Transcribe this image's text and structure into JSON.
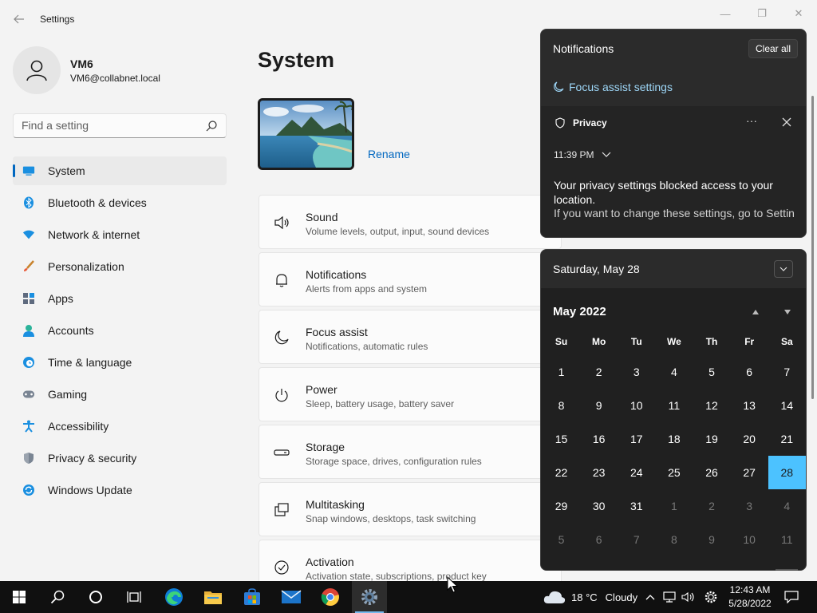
{
  "window": {
    "title": "Settings",
    "back_icon": "back-arrow-icon",
    "minimize_glyph": "—",
    "maximize_glyph": "❐",
    "close_glyph": "✕"
  },
  "profile": {
    "name": "VM6",
    "email": "VM6@collabnet.local"
  },
  "search": {
    "placeholder": "Find a setting"
  },
  "sidebar": {
    "items": [
      {
        "label": "System",
        "icon": "system-display-icon",
        "active": true
      },
      {
        "label": "Bluetooth & devices",
        "icon": "bluetooth-icon"
      },
      {
        "label": "Network & internet",
        "icon": "wifi-icon"
      },
      {
        "label": "Personalization",
        "icon": "brush-icon"
      },
      {
        "label": "Apps",
        "icon": "apps-icon"
      },
      {
        "label": "Accounts",
        "icon": "accounts-icon"
      },
      {
        "label": "Time & language",
        "icon": "globe-clock-icon"
      },
      {
        "label": "Gaming",
        "icon": "gamepad-icon"
      },
      {
        "label": "Accessibility",
        "icon": "accessibility-icon"
      },
      {
        "label": "Privacy & security",
        "icon": "shield-icon"
      },
      {
        "label": "Windows Update",
        "icon": "update-icon"
      }
    ]
  },
  "main": {
    "title": "System",
    "rename_label": "Rename",
    "cards": [
      {
        "title": "Sound",
        "subtitle": "Volume levels, output, input, sound devices",
        "icon": "speaker-icon"
      },
      {
        "title": "Notifications",
        "subtitle": "Alerts from apps and system",
        "icon": "bell-icon"
      },
      {
        "title": "Focus assist",
        "subtitle": "Notifications, automatic rules",
        "icon": "moon-icon"
      },
      {
        "title": "Power",
        "subtitle": "Sleep, battery usage, battery saver",
        "icon": "power-icon"
      },
      {
        "title": "Storage",
        "subtitle": "Storage space, drives, configuration rules",
        "icon": "drive-icon"
      },
      {
        "title": "Multitasking",
        "subtitle": "Snap windows, desktops, task switching",
        "icon": "multitask-icon"
      },
      {
        "title": "Activation",
        "subtitle": "Activation state, subscriptions, product key",
        "icon": "check-circle-icon"
      }
    ]
  },
  "notifications": {
    "header": "Notifications",
    "clear_all": "Clear all",
    "focus_assist_link": "Focus assist settings",
    "card": {
      "app": "Privacy",
      "more": "···",
      "time": "11:39 PM",
      "body": "Your privacy settings blocked access to your location.",
      "detail": "If you want to change these settings, go to Settin"
    }
  },
  "calendar": {
    "date_header": "Saturday, May 28",
    "month_label": "May 2022",
    "weekdays": [
      "Su",
      "Mo",
      "Tu",
      "We",
      "Th",
      "Fr",
      "Sa"
    ],
    "weeks": [
      [
        {
          "d": "1"
        },
        {
          "d": "2"
        },
        {
          "d": "3"
        },
        {
          "d": "4"
        },
        {
          "d": "5"
        },
        {
          "d": "6"
        },
        {
          "d": "7"
        }
      ],
      [
        {
          "d": "8"
        },
        {
          "d": "9"
        },
        {
          "d": "10"
        },
        {
          "d": "11"
        },
        {
          "d": "12"
        },
        {
          "d": "13"
        },
        {
          "d": "14"
        }
      ],
      [
        {
          "d": "15"
        },
        {
          "d": "16"
        },
        {
          "d": "17"
        },
        {
          "d": "18"
        },
        {
          "d": "19"
        },
        {
          "d": "20"
        },
        {
          "d": "21"
        }
      ],
      [
        {
          "d": "22"
        },
        {
          "d": "23"
        },
        {
          "d": "24"
        },
        {
          "d": "25"
        },
        {
          "d": "26"
        },
        {
          "d": "27"
        },
        {
          "d": "28",
          "today": true
        }
      ],
      [
        {
          "d": "29"
        },
        {
          "d": "30"
        },
        {
          "d": "31"
        },
        {
          "d": "1",
          "other": true
        },
        {
          "d": "2",
          "other": true
        },
        {
          "d": "3",
          "other": true
        },
        {
          "d": "4",
          "other": true
        }
      ],
      [
        {
          "d": "5",
          "other": true
        },
        {
          "d": "6",
          "other": true
        },
        {
          "d": "7",
          "other": true
        },
        {
          "d": "8",
          "other": true
        },
        {
          "d": "9",
          "other": true
        },
        {
          "d": "10",
          "other": true
        },
        {
          "d": "11",
          "other": true
        }
      ]
    ]
  },
  "taskbar": {
    "apps": [
      {
        "name": "start",
        "icon": "windows-start-icon"
      },
      {
        "name": "search",
        "icon": "search-icon"
      },
      {
        "name": "cortana",
        "icon": "cortana-circle-icon"
      },
      {
        "name": "task-view",
        "icon": "task-view-icon"
      },
      {
        "name": "edge",
        "icon": "edge-icon"
      },
      {
        "name": "file-explorer",
        "icon": "folder-icon"
      },
      {
        "name": "store",
        "icon": "store-icon"
      },
      {
        "name": "mail",
        "icon": "mail-icon"
      },
      {
        "name": "chrome",
        "icon": "chrome-icon"
      },
      {
        "name": "settings",
        "icon": "gear-icon",
        "active": true
      }
    ],
    "weather": {
      "temp": "18 °C",
      "condition": "Cloudy"
    },
    "clock": {
      "time": "12:43 AM",
      "date": "5/28/2022"
    }
  },
  "colors": {
    "accent": "#0067c0",
    "calendar_today": "#4cc2ff",
    "focus_link": "#9dd6f7"
  }
}
